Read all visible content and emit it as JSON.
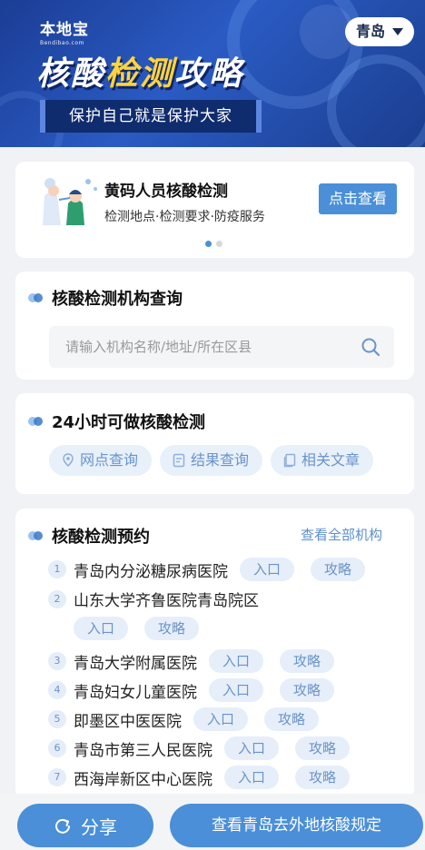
{
  "banner": {
    "brand_name": "本地宝",
    "brand_domain": "Bendibao.com",
    "title_part1": "核酸",
    "title_highlight": "检测",
    "title_part2": "攻略",
    "slogan": "保护自己就是保护大家",
    "city": "青岛"
  },
  "promo": {
    "title": "黄码人员核酸检测",
    "subtitle": "检测地点·检测要求·防疫服务",
    "button": "点击查看",
    "slides_total": 2,
    "slide_active": 1
  },
  "search_section": {
    "title": "核酸检测机构查询",
    "placeholder": "请输入机构名称/地址/所在区县"
  },
  "allday_section": {
    "title": "24小时可做核酸检测",
    "buttons": [
      {
        "label": "网点查询",
        "icon": "location-pin-icon"
      },
      {
        "label": "结果查询",
        "icon": "report-icon"
      },
      {
        "label": "相关文章",
        "icon": "document-icon"
      }
    ]
  },
  "booking_section": {
    "title": "核酸检测预约",
    "view_all": "查看全部机构",
    "entry_label": "入口",
    "guide_label": "攻略",
    "hospitals": [
      {
        "num": "1",
        "name": "青岛内分泌糖尿病医院"
      },
      {
        "num": "2",
        "name": "山东大学齐鲁医院青岛院区"
      },
      {
        "num": "3",
        "name": "青岛大学附属医院"
      },
      {
        "num": "4",
        "name": "青岛妇女儿童医院"
      },
      {
        "num": "5",
        "name": "即墨区中医医院"
      },
      {
        "num": "6",
        "name": "青岛市第三人民医院"
      },
      {
        "num": "7",
        "name": "西海岸新区中心医院"
      }
    ]
  },
  "bottom": {
    "share": "分享",
    "rules": "查看青岛去外地核酸规定"
  },
  "colors": {
    "accent": "#4a8fd8",
    "banner_bg": "#2a5bc3",
    "highlight": "#ffd43b",
    "pill_bg": "#e8f0fa",
    "pill_text": "#6a94c8"
  }
}
